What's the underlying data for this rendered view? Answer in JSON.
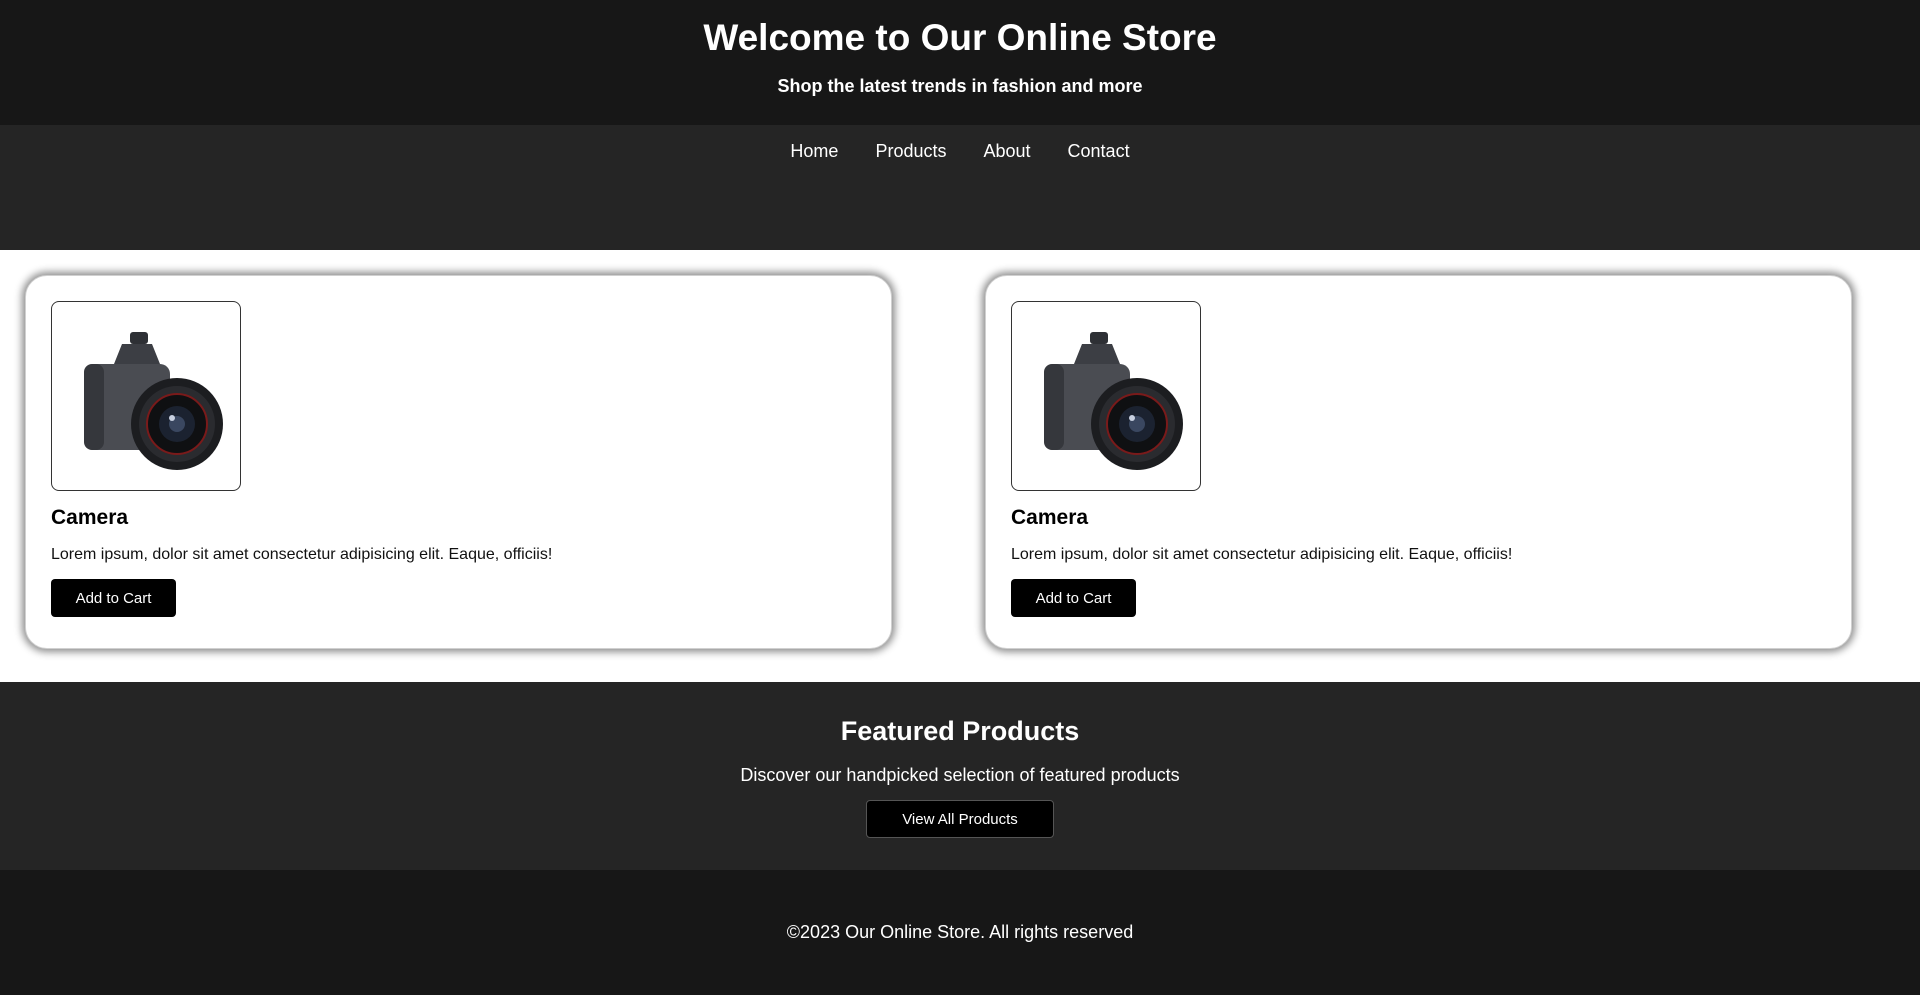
{
  "header": {
    "title": "Welcome to Our Online Store",
    "tagline": "Shop the latest trends in fashion and more"
  },
  "nav": {
    "items": [
      {
        "label": "Home"
      },
      {
        "label": "Products"
      },
      {
        "label": "About"
      },
      {
        "label": "Contact"
      }
    ]
  },
  "products": [
    {
      "name": "Camera",
      "description": "Lorem ipsum, dolor sit amet consectetur adipisicing elit. Eaque, officiis!",
      "button_label": "Add to Cart",
      "image_icon": "camera-icon"
    },
    {
      "name": "Camera",
      "description": "Lorem ipsum, dolor sit amet consectetur adipisicing elit. Eaque, officiis!",
      "button_label": "Add to Cart",
      "image_icon": "camera-icon"
    }
  ],
  "featured": {
    "title": "Featured Products",
    "text": "Discover our handpicked selection of featured products",
    "button_label": "View All Products"
  },
  "footer": {
    "copyright": "©2023 Our Online Store. All rights reserved"
  },
  "colors": {
    "header_bg": "#171717",
    "nav_bg": "#252525",
    "button_bg": "#000000",
    "text_light": "#ffffff"
  }
}
